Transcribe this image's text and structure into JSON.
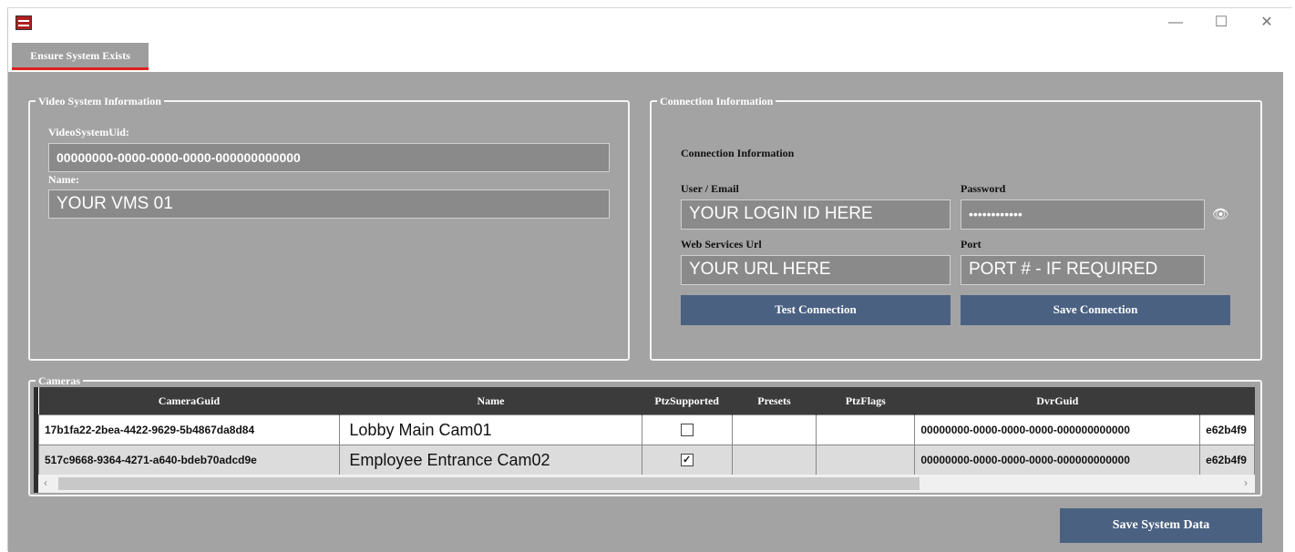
{
  "window": {
    "controls": {
      "minimize": "—",
      "maximize": "☐",
      "close": "✕"
    }
  },
  "tabs": [
    {
      "label": "Ensure System Exists",
      "active": true,
      "accent": "#e02020"
    }
  ],
  "video_system": {
    "legend": "Video System Information",
    "uid_label": "VideoSystemUid:",
    "uid_value": "00000000-0000-0000-0000-000000000000",
    "name_label": "Name:",
    "name_value": "YOUR VMS 01"
  },
  "connection": {
    "legend": "Connection Information",
    "heading": "Connection Information",
    "user_label": "User / Email",
    "user_value": "YOUR LOGIN ID HERE",
    "password_label": "Password",
    "password_value": "••••••••••••",
    "url_label": "Web Services Url",
    "url_value": "YOUR URL HERE",
    "port_label": "Port",
    "port_value": "PORT # - IF REQUIRED",
    "test_button": "Test Connection",
    "save_button": "Save Connection"
  },
  "cameras": {
    "legend": "Cameras",
    "columns": [
      "CameraGuid",
      "Name",
      "PtzSupported",
      "Presets",
      "PtzFlags",
      "DvrGuid",
      ""
    ],
    "rows": [
      {
        "guid": "17b1fa22-2bea-4422-9629-5b4867da8d84",
        "name": "Lobby Main Cam01",
        "ptz": false,
        "presets": "",
        "ptzflags": "",
        "dvr": "00000000-0000-0000-0000-000000000000",
        "extra": "e62b4f9"
      },
      {
        "guid": "517c9668-9364-4271-a640-bdeb70adcd9e",
        "name": "Employee Entrance Cam02",
        "ptz": true,
        "presets": "",
        "ptzflags": "",
        "dvr": "00000000-0000-0000-0000-000000000000",
        "extra": "e62b4f9"
      }
    ]
  },
  "footer": {
    "save_system_button": "Save System Data"
  },
  "colors": {
    "panel": "#a3a3a3",
    "button": "#4a6182",
    "grid_header": "#3b3b3b",
    "tab_accent": "#e02020"
  }
}
